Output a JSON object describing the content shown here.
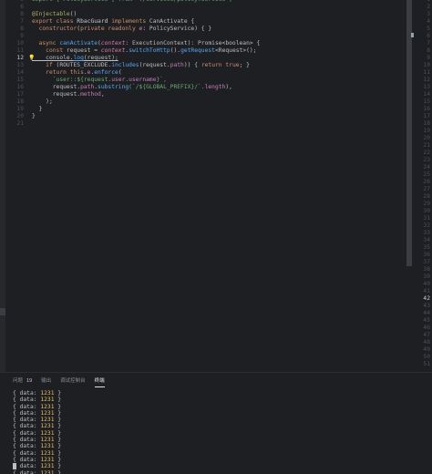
{
  "editor": {
    "lines": [
      {
        "n": "5",
        "tokens": [
          {
            "t": "import { PolicyService } from './services/policy.service';",
            "c": "str"
          }
        ]
      },
      {
        "n": "6",
        "tokens": []
      },
      {
        "n": "8",
        "tokens": [
          {
            "t": "@Injectable",
            "c": "ann"
          },
          {
            "t": "()",
            "c": "pl"
          }
        ]
      },
      {
        "n": "7",
        "tokens": [
          {
            "t": "export ",
            "c": "kw"
          },
          {
            "t": "class ",
            "c": "kw"
          },
          {
            "t": "RbacGuard ",
            "c": "cls"
          },
          {
            "t": "implements ",
            "c": "kw"
          },
          {
            "t": "CanActivate {",
            "c": "pl"
          }
        ]
      },
      {
        "n": "8",
        "tokens": [
          {
            "t": "  constructor",
            "c": "kw"
          },
          {
            "t": "(",
            "c": "pl"
          },
          {
            "t": "private readonly ",
            "c": "kw"
          },
          {
            "t": "e",
            "c": "par"
          },
          {
            "t": ": PolicyService) { }",
            "c": "pl"
          }
        ]
      },
      {
        "n": "9",
        "tokens": []
      },
      {
        "n": "10",
        "tokens": [
          {
            "t": "  async ",
            "c": "kw"
          },
          {
            "t": "canActivate",
            "c": "fn"
          },
          {
            "t": "(",
            "c": "pl"
          },
          {
            "t": "context",
            "c": "par"
          },
          {
            "t": ": ExecutionContext): Promise<boolean> {",
            "c": "pl"
          }
        ]
      },
      {
        "n": "11",
        "tokens": [
          {
            "t": "    const ",
            "c": "kw"
          },
          {
            "t": "request = ",
            "c": "pl"
          },
          {
            "t": "context",
            "c": "par"
          },
          {
            "t": ".",
            "c": "pl"
          },
          {
            "t": "switchToHttp",
            "c": "fn"
          },
          {
            "t": "().",
            "c": "pl"
          },
          {
            "t": "getRequest",
            "c": "fn"
          },
          {
            "t": "<Request>();",
            "c": "pl"
          }
        ]
      },
      {
        "n": "12",
        "cur": true,
        "tokens": [
          {
            "t": "    console.",
            "c": "pl",
            "ul": true
          },
          {
            "t": "log",
            "c": "fn",
            "ul": true
          },
          {
            "t": "(request);",
            "c": "pl",
            "ul": true
          }
        ]
      },
      {
        "n": "13",
        "tokens": [
          {
            "t": "    if ",
            "c": "kw"
          },
          {
            "t": "(ROUTES_EXCLUDE.",
            "c": "pl"
          },
          {
            "t": "includes",
            "c": "fn"
          },
          {
            "t": "(request.",
            "c": "pl"
          },
          {
            "t": "path",
            "c": "prop"
          },
          {
            "t": ")) { ",
            "c": "pl"
          },
          {
            "t": "return true",
            "c": "kw"
          },
          {
            "t": "; }",
            "c": "pl"
          }
        ]
      },
      {
        "n": "14",
        "tokens": [
          {
            "t": "    return this",
            "c": "kw"
          },
          {
            "t": ".",
            "c": "pl"
          },
          {
            "t": "e",
            "c": "prop"
          },
          {
            "t": ".",
            "c": "pl"
          },
          {
            "t": "enforce",
            "c": "fn"
          },
          {
            "t": "(",
            "c": "pl"
          }
        ]
      },
      {
        "n": "15",
        "tokens": [
          {
            "t": "      `user::${request.",
            "c": "str"
          },
          {
            "t": "user",
            "c": "prop"
          },
          {
            "t": ".",
            "c": "str"
          },
          {
            "t": "username",
            "c": "prop"
          },
          {
            "t": "}`,",
            "c": "str"
          }
        ]
      },
      {
        "n": "16",
        "tokens": [
          {
            "t": "      request.",
            "c": "pl"
          },
          {
            "t": "path",
            "c": "prop"
          },
          {
            "t": ".",
            "c": "pl"
          },
          {
            "t": "substring",
            "c": "fn"
          },
          {
            "t": "(`/${GLOBAL_PREFIX}/`.",
            "c": "str"
          },
          {
            "t": "length",
            "c": "prop"
          },
          {
            "t": "),",
            "c": "pl"
          }
        ]
      },
      {
        "n": "17",
        "tokens": [
          {
            "t": "      request.",
            "c": "pl"
          },
          {
            "t": "method",
            "c": "prop"
          },
          {
            "t": ",",
            "c": "pl"
          }
        ]
      },
      {
        "n": "18",
        "tokens": [
          {
            "t": "    );",
            "c": "pl"
          }
        ]
      },
      {
        "n": "19",
        "tokens": [
          {
            "t": "  }",
            "c": "pl"
          }
        ]
      },
      {
        "n": "20",
        "tokens": [
          {
            "t": "}",
            "c": "pl"
          }
        ]
      },
      {
        "n": "21",
        "tokens": []
      }
    ],
    "right_gutter": [
      "1",
      "2",
      "3",
      "4",
      "5",
      "6",
      "7",
      "8",
      "9",
      "10",
      "11",
      "12",
      "13",
      "14",
      "15",
      "16",
      "17",
      "18",
      "19",
      "20",
      "21",
      "22",
      "23",
      "24",
      "25",
      "26",
      "27",
      "28",
      "29",
      "30",
      "31",
      "32",
      "33",
      "34",
      "35",
      "36",
      "37",
      "38",
      "39",
      "40",
      "41",
      "42",
      "43",
      "44",
      "45",
      "46",
      "47",
      "48",
      "49",
      "50",
      "51"
    ],
    "right_current": "42"
  },
  "panel": {
    "tabs": [
      {
        "label": "问题",
        "badge": "19"
      },
      {
        "label": "输出",
        "badge": ""
      },
      {
        "label": "调试控制台",
        "badge": ""
      },
      {
        "label": "终端",
        "badge": "",
        "active": true
      }
    ],
    "terminal_lines": [
      {
        "prefix": "{ data: ",
        "num": "1231",
        "suffix": " }"
      },
      {
        "prefix": "{ data: ",
        "num": "1231",
        "suffix": " }"
      },
      {
        "prefix": "{ data: ",
        "num": "1231",
        "suffix": " }"
      },
      {
        "prefix": "{ data: ",
        "num": "1231",
        "suffix": " }"
      },
      {
        "prefix": "{ data: ",
        "num": "1231",
        "suffix": " }"
      },
      {
        "prefix": "{ data: ",
        "num": "1231",
        "suffix": " }"
      },
      {
        "prefix": "{ data: ",
        "num": "1231",
        "suffix": " }"
      },
      {
        "prefix": "{ data: ",
        "num": "1231",
        "suffix": " }"
      },
      {
        "prefix": "{ data: ",
        "num": "1231",
        "suffix": " }"
      },
      {
        "prefix": "{ data: ",
        "num": "1231",
        "suffix": " }"
      },
      {
        "prefix": "{ data: ",
        "num": "1231",
        "suffix": " }"
      },
      {
        "prefix": "{ data: ",
        "num": "1231",
        "suffix": " }"
      },
      {
        "prefix": "{ data: ",
        "num": "1231",
        "suffix": " }"
      }
    ]
  },
  "colors": {
    "background": "#1e1f22",
    "keyword": "#cf8e6d",
    "string": "#6aab73",
    "function": "#56a8f5",
    "number": "#e8bf6a"
  },
  "icons": {
    "lightbulb": "lightbulb-icon"
  }
}
